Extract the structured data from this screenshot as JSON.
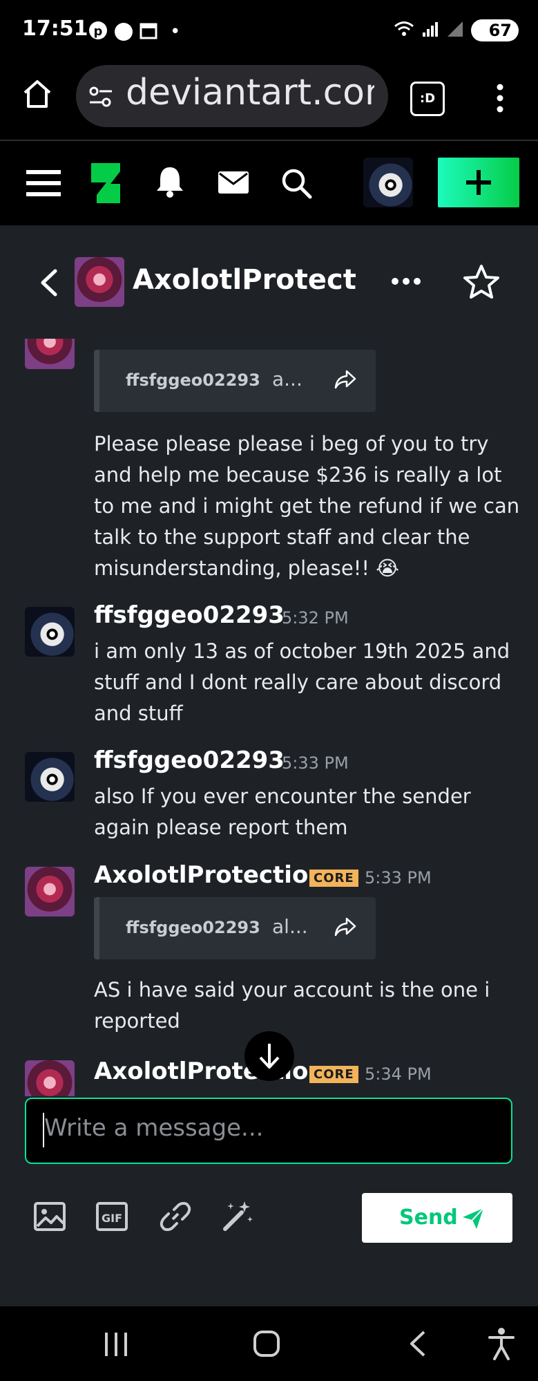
{
  "status_bar": {
    "time": "17:51",
    "notif_dot": "•",
    "battery": "67"
  },
  "browser": {
    "url": "deviantart.com/",
    "tabs_icon_label": ":D"
  },
  "conversation": {
    "title": "AxolotlProtection"
  },
  "messages": [
    {
      "quote": {
        "user": "ffsfggeo02293",
        "snippet": "a..."
      },
      "text": "Please please please i beg of you to try and help me because $236 is really a lot to me and i might get the refund if we can talk to the support staff and clear the misunderstanding, please!! 😭"
    },
    {
      "user": "ffsfggeo02293",
      "time": "5:32 PM",
      "text": "i am only 13 as of october 19th 2025 and stuff and I dont really care about discord and stuff"
    },
    {
      "user": "ffsfggeo02293",
      "time": "5:33 PM",
      "text": "also If you ever encounter the sender again please report them"
    },
    {
      "user": "AxolotlProtection",
      "badge": "CORE",
      "time": "5:33 PM",
      "quote": {
        "user": "ffsfggeo02293",
        "snippet": "al..."
      },
      "text": "AS i have said your account is the one i reported"
    },
    {
      "user": "AxolotlProtection",
      "badge": "CORE",
      "time": "5:34 PM"
    }
  ],
  "composer": {
    "placeholder": "Write a message..."
  },
  "send_label": "Send",
  "colors": {
    "accent": "#00e59b",
    "core_badge": "#f2b35a",
    "chat_bg": "#1e2227"
  }
}
